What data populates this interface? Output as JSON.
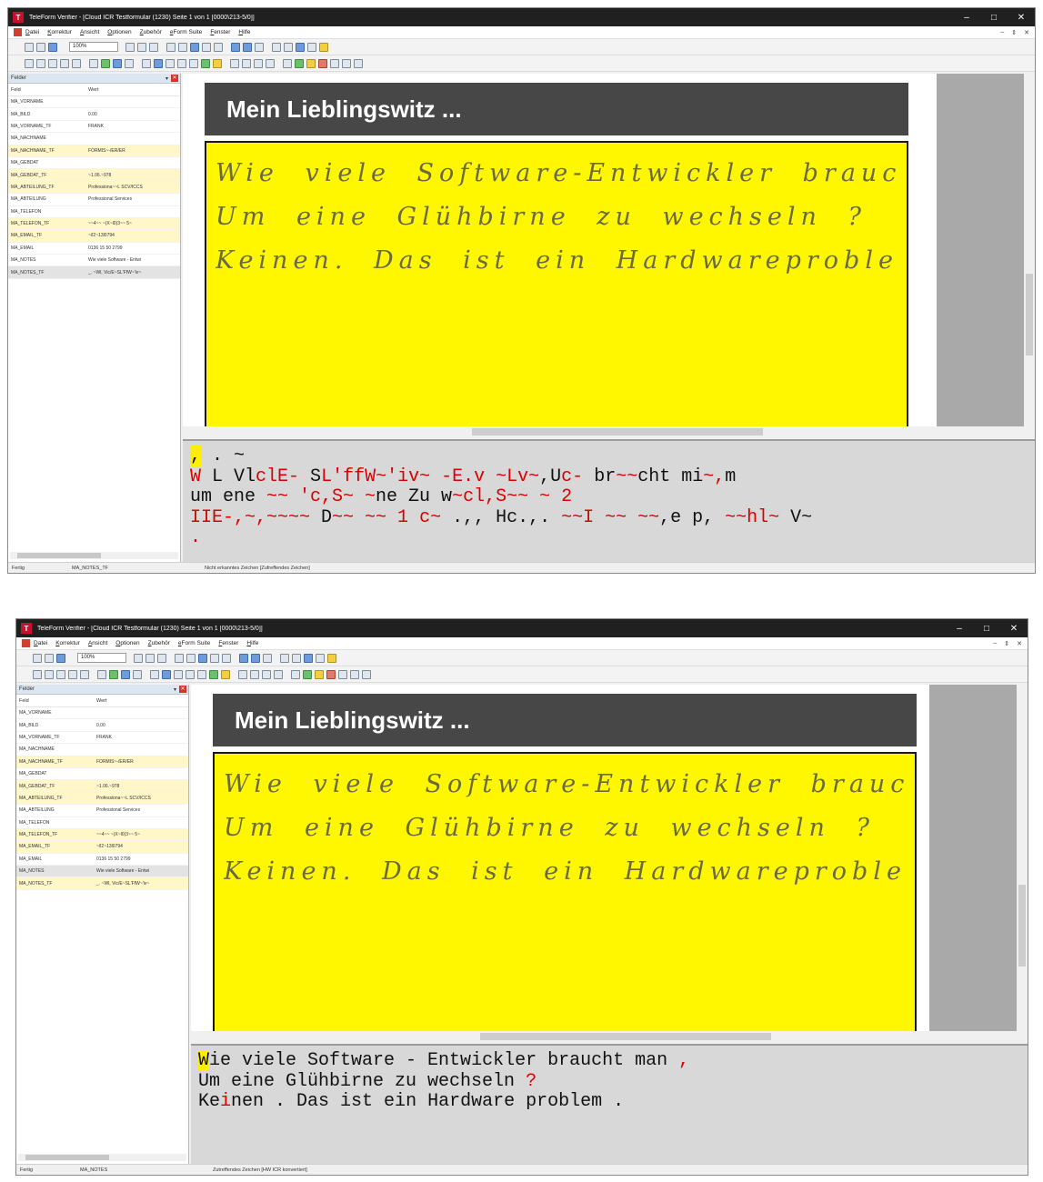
{
  "screens": [
    {
      "title": "TeleForm Verifier - [Cloud ICR Testformular (1230) Seite 1 von 1 [0000\\213-5/0]]",
      "menu": [
        "Datei",
        "Korrektur",
        "Ansicht",
        "Optionen",
        "Zubehör",
        "eForm Suite",
        "Fenster",
        "Hilfe"
      ],
      "zoom": "100%",
      "panel_title": "Felder",
      "columns": [
        "Feld",
        "Wert"
      ],
      "fields": [
        {
          "name": "MA_VORNAME",
          "value": "",
          "hl": false
        },
        {
          "name": "MA_BILD",
          "value": "0.00",
          "hl": false
        },
        {
          "name": "MA_VORNAME_TF",
          "value": "FRANK",
          "hl": false
        },
        {
          "name": "MA_NACHNAME",
          "value": "",
          "hl": false
        },
        {
          "name": "MA_NACHNAME_TF",
          "value": "FORMIS~-/ER/ER",
          "hl": true
        },
        {
          "name": "MA_GEBDAT",
          "value": "",
          "hl": false
        },
        {
          "name": "MA_GEBDAT_TF",
          "value": "~1.06.~978",
          "hl": true
        },
        {
          "name": "MA_ABTEILUNG_TF",
          "value": "Professiona~~L SCV/ICCS",
          "hl": true
        },
        {
          "name": "MA_ABTEILUNG",
          "value": "Professional Services",
          "hl": false
        },
        {
          "name": "MA_TELEFON",
          "value": "",
          "hl": false
        },
        {
          "name": "MA_TELEFON_TF",
          "value": "~~4~~ ~(X~l0)3~~ 5~",
          "hl": true
        },
        {
          "name": "MA_EMAIL_TF",
          "value": "~/l2~13l0794",
          "hl": true
        },
        {
          "name": "MA_EMAIL",
          "value": "0136 15 50 2799",
          "hl": false
        },
        {
          "name": "MA_NOTES",
          "value": "Wie viele Software - Entwi",
          "hl": false
        },
        {
          "name": "MA_NOTES_TF",
          "value": "_. ~Wl, Vic/E~SL'FfW~'iv~",
          "hl": false
        }
      ],
      "selected_row": 14,
      "form_title": "Mein Lieblingswitz ...",
      "handwriting": [
        "Wie viele Software-Entwickler braucht man,",
        "Um eine Glühbirne zu wechseln ?",
        "Keinen. Das ist ein Hardwareproblem."
      ],
      "ocr_lines": [
        [
          {
            "t": ",",
            "c": "cur"
          },
          {
            "t": " . ~",
            "c": ""
          }
        ],
        [
          {
            "t": "W",
            "c": "red"
          },
          {
            "t": " L Vl",
            "c": ""
          },
          {
            "t": "clE-",
            "c": "red"
          },
          {
            "t": " S",
            "c": ""
          },
          {
            "t": "L'ffW~'iv~",
            "c": "red"
          },
          {
            "t": " ",
            "c": ""
          },
          {
            "t": "-E.v",
            "c": "red"
          },
          {
            "t": " ",
            "c": ""
          },
          {
            "t": "~Lv~",
            "c": "red"
          },
          {
            "t": ",U",
            "c": ""
          },
          {
            "t": "c-",
            "c": "red"
          },
          {
            "t": " br",
            "c": ""
          },
          {
            "t": "~~",
            "c": "red"
          },
          {
            "t": "cht mi",
            "c": ""
          },
          {
            "t": "~,",
            "c": "red"
          },
          {
            "t": "m",
            "c": ""
          }
        ],
        [
          {
            "t": "um ene ",
            "c": ""
          },
          {
            "t": "~~ 'c,S~ ~",
            "c": "red"
          },
          {
            "t": "ne Zu w",
            "c": ""
          },
          {
            "t": "~cl,S~~ ~",
            "c": "red"
          },
          {
            "t": " ",
            "c": ""
          },
          {
            "t": "2",
            "c": "red"
          }
        ],
        [
          {
            "t": "IIE-,~,~~~~",
            "c": "red"
          },
          {
            "t": " D",
            "c": ""
          },
          {
            "t": "~~ ~~ 1 c~",
            "c": "red"
          },
          {
            "t": " .,, Hc.,. ",
            "c": ""
          },
          {
            "t": "~~I ~~ ~~",
            "c": "red"
          },
          {
            "t": ",e p, ",
            "c": ""
          },
          {
            "t": "~~hl~",
            "c": "red"
          },
          {
            "t": " V~",
            "c": ""
          }
        ],
        [
          {
            "t": ".",
            "c": "red"
          }
        ]
      ],
      "status": [
        "Fertig",
        "MA_NOTES_TF",
        "Nicht erkanntes Zeichen [Zufreffendes Zeichen]"
      ]
    },
    {
      "title": "TeleForm Verifier - [Cloud ICR Testformular (1230) Seite 1 von 1 [0000\\213-5/0]]",
      "menu": [
        "Datei",
        "Korrektur",
        "Ansicht",
        "Optionen",
        "Zubehör",
        "eForm Suite",
        "Fenster",
        "Hilfe"
      ],
      "zoom": "100%",
      "panel_title": "Felder",
      "columns": [
        "Feld",
        "Wert"
      ],
      "fields": [
        {
          "name": "MA_VORNAME",
          "value": "",
          "hl": false
        },
        {
          "name": "MA_BILD",
          "value": "0.00",
          "hl": false
        },
        {
          "name": "MA_VORNAME_TF",
          "value": "FRANK",
          "hl": false
        },
        {
          "name": "MA_NACHNAME",
          "value": "",
          "hl": false
        },
        {
          "name": "MA_NACHNAME_TF",
          "value": "FORMIS~-/ER/ER",
          "hl": true
        },
        {
          "name": "MA_GEBDAT",
          "value": "",
          "hl": false
        },
        {
          "name": "MA_GEBDAT_TF",
          "value": "~1.06.~978",
          "hl": true
        },
        {
          "name": "MA_ABTEILUNG_TF",
          "value": "Professiona~~L SCV/ICCS",
          "hl": true
        },
        {
          "name": "MA_ABTEILUNG",
          "value": "Professional Services",
          "hl": false
        },
        {
          "name": "MA_TELEFON",
          "value": "",
          "hl": false
        },
        {
          "name": "MA_TELEFON_TF",
          "value": "~~4~~ ~(X~l0)3~~ 5~",
          "hl": true
        },
        {
          "name": "MA_EMAIL_TF",
          "value": "~/l2~13l0794",
          "hl": true
        },
        {
          "name": "MA_EMAIL",
          "value": "0136 15 50 2799",
          "hl": false
        },
        {
          "name": "MA_NOTES",
          "value": "Wie viele Software - Entwi",
          "hl": false
        },
        {
          "name": "MA_NOTES_TF",
          "value": "_. ~Wl, Vic/E~SL'FfW~'iv~",
          "hl": true
        }
      ],
      "selected_row": 13,
      "form_title": "Mein Lieblingswitz ...",
      "handwriting": [
        "Wie viele Software-Entwickler braucht man,",
        "Um eine Glühbirne zu wechseln ?",
        "Keinen. Das ist ein Hardwareproblem."
      ],
      "ocr_lines": [
        [
          {
            "t": "W",
            "c": "cur"
          },
          {
            "t": "ie viele Software - Entwickler braucht man ",
            "c": ""
          },
          {
            "t": ",",
            "c": "red"
          }
        ],
        [
          {
            "t": "Um eine Glühbirne zu wechseln ",
            "c": ""
          },
          {
            "t": "?",
            "c": "red"
          }
        ],
        [
          {
            "t": "Ke",
            "c": ""
          },
          {
            "t": "i",
            "c": "red"
          },
          {
            "t": "nen . Das ist ein Hardware problem .",
            "c": ""
          }
        ]
      ],
      "status": [
        "Fertig",
        "MA_NOTES",
        "Zutreffendes Zeichen [HW ICR konvertiert]"
      ]
    }
  ]
}
